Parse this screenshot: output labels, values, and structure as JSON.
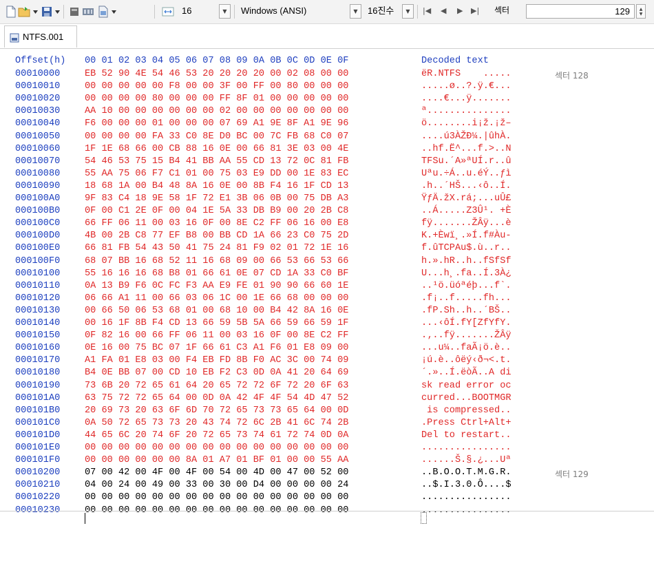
{
  "toolbar": {
    "offset_value": "16",
    "encoding_value": "Windows (ANSI)",
    "radix_value": "16진수",
    "sector_label": "섹터",
    "sector_value": "129"
  },
  "tabs": [
    {
      "label": "NTFS.001"
    }
  ],
  "hex_header": {
    "offset_label": "Offset(h)",
    "columns": "00 01 02 03 04 05 06 07 08 09 0A 0B 0C 0D 0E 0F",
    "decoded_label": "Decoded text"
  },
  "rows": [
    {
      "offset": "00010000",
      "bytes": "EB 52 90 4E 54 46 53 20 20 20 20 00 02 08 00 00",
      "text": "ëR.NTFS    .....",
      "sector": "섹터 128"
    },
    {
      "offset": "00010010",
      "bytes": "00 00 00 00 00 F8 00 00 3F 00 FF 00 80 00 00 00",
      "text": ".....ø..?.ÿ.€...",
      "sector": ""
    },
    {
      "offset": "00010020",
      "bytes": "00 00 00 00 80 00 00 00 FF 8F 01 00 00 00 00 00",
      "text": "....€...ÿ.......",
      "sector": ""
    },
    {
      "offset": "00010030",
      "bytes": "AA 10 00 00 00 00 00 00 02 00 00 00 00 00 00 00",
      "text": "ª...............",
      "sector": ""
    },
    {
      "offset": "00010040",
      "bytes": "F6 00 00 00 01 00 00 00 07 69 A1 9E 8F A1 9E 96",
      "text": "ö........i¡ž.¡ž–",
      "sector": ""
    },
    {
      "offset": "00010050",
      "bytes": "00 00 00 00 FA 33 C0 8E D0 BC 00 7C FB 68 C0 07",
      "text": "....ú3ÀŽÐ¼.|ûhÀ.",
      "sector": ""
    },
    {
      "offset": "00010060",
      "bytes": "1F 1E 68 66 00 CB 88 16 0E 00 66 81 3E 03 00 4E",
      "text": "..hf.Ë^...f.>..N",
      "sector": ""
    },
    {
      "offset": "00010070",
      "bytes": "54 46 53 75 15 B4 41 BB AA 55 CD 13 72 0C 81 FB",
      "text": "TFSu.´A»ªUÍ.r..û",
      "sector": ""
    },
    {
      "offset": "00010080",
      "bytes": "55 AA 75 06 F7 C1 01 00 75 03 E9 DD 00 1E 83 EC",
      "text": "Uªu.÷Á..u.éÝ..ƒì",
      "sector": ""
    },
    {
      "offset": "00010090",
      "bytes": "18 68 1A 00 B4 48 8A 16 0E 00 8B F4 16 1F CD 13",
      "text": ".h..´HŠ...‹ô..Í.",
      "sector": ""
    },
    {
      "offset": "000100A0",
      "bytes": "9F 83 C4 18 9E 58 1F 72 E1 3B 06 0B 00 75 DB A3",
      "text": "ŸƒÄ.žX.rá;...uÛ£",
      "sector": ""
    },
    {
      "offset": "000100B0",
      "bytes": "0F 00 C1 2E 0F 00 04 1E 5A 33 DB B9 00 20 2B C8",
      "text": "..Á.....Z3Û¹. +È",
      "sector": ""
    },
    {
      "offset": "000100C0",
      "bytes": "66 FF 06 11 00 03 16 0F 00 8E C2 FF 06 16 00 E8",
      "text": "fÿ.......ŽÂÿ...è",
      "sector": ""
    },
    {
      "offset": "000100D0",
      "bytes": "4B 00 2B C8 77 EF B8 00 BB CD 1A 66 23 C0 75 2D",
      "text": "K.+Èwï¸.»Í.f#Àu-",
      "sector": ""
    },
    {
      "offset": "000100E0",
      "bytes": "66 81 FB 54 43 50 41 75 24 81 F9 02 01 72 1E 16",
      "text": "f.ûTCPAu$.ù..r..",
      "sector": ""
    },
    {
      "offset": "000100F0",
      "bytes": "68 07 BB 16 68 52 11 16 68 09 00 66 53 66 53 66",
      "text": "h.».hR..h..fSfSf",
      "sector": ""
    },
    {
      "offset": "00010100",
      "bytes": "55 16 16 16 68 B8 01 66 61 0E 07 CD 1A 33 C0 BF",
      "text": "U...h¸.fa..Í.3À¿",
      "sector": ""
    },
    {
      "offset": "00010110",
      "bytes": "0A 13 B9 F6 0C FC F3 AA E9 FE 01 90 90 66 60 1E",
      "text": "..¹ö.üóªéþ...f`.",
      "sector": ""
    },
    {
      "offset": "00010120",
      "bytes": "06 66 A1 11 00 66 03 06 1C 00 1E 66 68 00 00 00",
      "text": ".f¡..f.....fh...",
      "sector": ""
    },
    {
      "offset": "00010130",
      "bytes": "00 66 50 06 53 68 01 00 68 10 00 B4 42 8A 16 0E",
      "text": ".fP.Sh..h..´BŠ..",
      "sector": ""
    },
    {
      "offset": "00010140",
      "bytes": "00 16 1F 8B F4 CD 13 66 59 5B 5A 66 59 66 59 1F",
      "text": "...‹ôÍ.fY[ZfYfY.",
      "sector": ""
    },
    {
      "offset": "00010150",
      "bytes": "0F 82 16 00 66 FF 06 11 00 03 16 0F 00 8E C2 FF",
      "text": ".‚..fÿ.......ŽÂÿ",
      "sector": ""
    },
    {
      "offset": "00010160",
      "bytes": "0E 16 00 75 BC 07 1F 66 61 C3 A1 F6 01 E8 09 00",
      "text": "...u¼..faÃ¡ö.è..",
      "sector": ""
    },
    {
      "offset": "00010170",
      "bytes": "A1 FA 01 E8 03 00 F4 EB FD 8B F0 AC 3C 00 74 09",
      "text": "¡ú.è..ôëý‹ð¬<.t.",
      "sector": ""
    },
    {
      "offset": "00010180",
      "bytes": "B4 0E BB 07 00 CD 10 EB F2 C3 0D 0A 41 20 64 69",
      "text": "´.»..Í.ëòÃ..A di",
      "sector": ""
    },
    {
      "offset": "00010190",
      "bytes": "73 6B 20 72 65 61 64 20 65 72 72 6F 72 20 6F 63",
      "text": "sk read error oc",
      "sector": ""
    },
    {
      "offset": "000101A0",
      "bytes": "63 75 72 72 65 64 00 0D 0A 42 4F 4F 54 4D 47 52",
      "text": "curred...BOOTMGR",
      "sector": ""
    },
    {
      "offset": "000101B0",
      "bytes": "20 69 73 20 63 6F 6D 70 72 65 73 73 65 64 00 0D",
      "text": " is compressed..",
      "sector": ""
    },
    {
      "offset": "000101C0",
      "bytes": "0A 50 72 65 73 73 20 43 74 72 6C 2B 41 6C 74 2B",
      "text": ".Press Ctrl+Alt+",
      "sector": ""
    },
    {
      "offset": "000101D0",
      "bytes": "44 65 6C 20 74 6F 20 72 65 73 74 61 72 74 0D 0A",
      "text": "Del to restart..",
      "sector": ""
    },
    {
      "offset": "000101E0",
      "bytes": "00 00 00 00 00 00 00 00 00 00 00 00 00 00 00 00",
      "text": "................",
      "sector": ""
    },
    {
      "offset": "000101F0",
      "bytes": "00 00 00 00 00 00 8A 01 A7 01 BF 01 00 00 55 AA",
      "text": "......Š.§.¿...Uª",
      "sector": ""
    },
    {
      "offset": "00010200",
      "bytes": "07 00 42 00 4F 00 4F 00 54 00 4D 00 47 00 52 00",
      "text": "..B.O.O.T.M.G.R.",
      "sector": "섹터 129"
    },
    {
      "offset": "00010210",
      "bytes": "04 00 24 00 49 00 33 00 30 00 D4 00 00 00 00 24",
      "text": "..$.I.3.0.Ô....$",
      "sector": ""
    },
    {
      "offset": "00010220",
      "bytes": "00 00 00 00 00 00 00 00 00 00 00 00 00 00 00 00",
      "text": "................",
      "sector": ""
    },
    {
      "offset": "00010230",
      "bytes": "00 00 00 00 00 00 00 00 00 00 00 00 00 00 00 00",
      "text": "................",
      "sector": ""
    }
  ]
}
